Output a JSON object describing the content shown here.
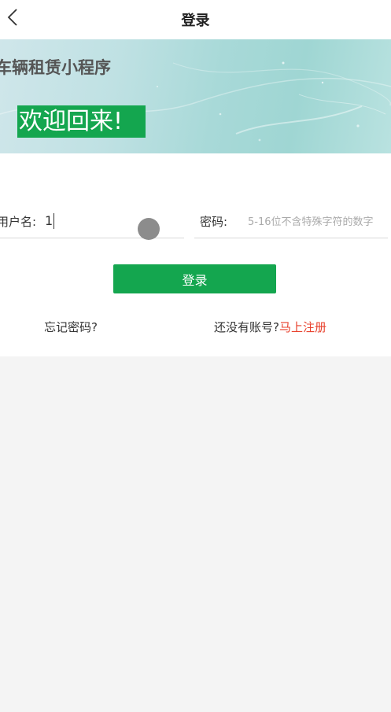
{
  "nav": {
    "title": "登录",
    "back_icon": "chevron-left-icon"
  },
  "banner": {
    "app_name": "车辆租赁小程序",
    "welcome": "欢迎回来!"
  },
  "form": {
    "username_label": "用户名:",
    "username_value": "1",
    "password_label": "密码:",
    "password_placeholder": "5-16位不含特殊字符的数字",
    "login_button": "登录"
  },
  "links": {
    "forgot_password": "忘记密码?",
    "no_account_prefix": "还没有账号?",
    "register_now": "马上注册"
  },
  "colors": {
    "accent_green": "#14a64f",
    "register_red": "#e8402c",
    "page_background": "#f4f4f4"
  }
}
